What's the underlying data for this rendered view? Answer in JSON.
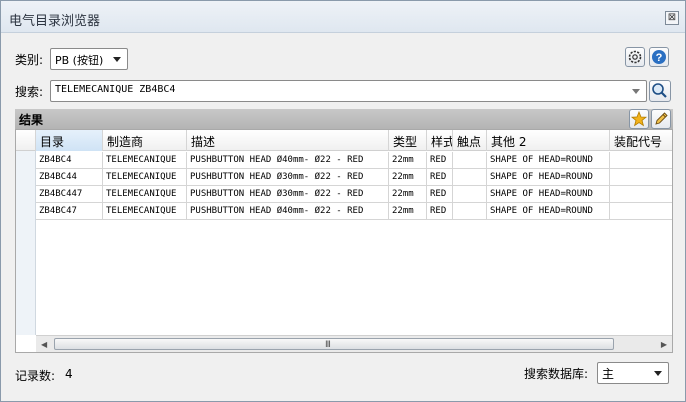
{
  "window": {
    "title": "电气目录浏览器",
    "close_label": "⊠"
  },
  "category": {
    "label": "类别:",
    "value": "PB (按钮)"
  },
  "search": {
    "label": "搜索:",
    "value": "TELEMECANIQUE ZB4BC4"
  },
  "results": {
    "label": "结果",
    "columns": [
      "目录",
      "制造商",
      "描述",
      "类型",
      "样式",
      "触点",
      "其他 2",
      "装配代号"
    ],
    "rows": [
      [
        "ZB4BC4",
        "TELEMECANIQUE",
        "PUSHBUTTON HEAD Ø40mm- Ø22 - RED",
        "22mm",
        "RED",
        "",
        "SHAPE OF HEAD=ROUND",
        ""
      ],
      [
        "ZB4BC44",
        "TELEMECANIQUE",
        "PUSHBUTTON HEAD Ø30mm- Ø22 - RED",
        "22mm",
        "RED",
        "",
        "SHAPE OF HEAD=ROUND",
        ""
      ],
      [
        "ZB4BC447",
        "TELEMECANIQUE",
        "PUSHBUTTON HEAD Ø30mm- Ø22 - RED",
        "22mm",
        "RED",
        "",
        "SHAPE OF HEAD=ROUND",
        ""
      ],
      [
        "ZB4BC47",
        "TELEMECANIQUE",
        "PUSHBUTTON HEAD Ø40mm- Ø22 - RED",
        "22mm",
        "RED",
        "",
        "SHAPE OF HEAD=ROUND",
        ""
      ]
    ],
    "scroll_grip": "III"
  },
  "footer": {
    "record_count_label": "记录数:",
    "record_count": "4",
    "db_label": "搜索数据库:",
    "db_value": "主"
  },
  "icons": {
    "settings": "gear-icon",
    "help": "help-icon",
    "search": "magnifier-icon",
    "favorite": "star-icon",
    "edit": "pencil-icon"
  },
  "colors": {
    "title_bg": "#dfe7f0",
    "section_bar": "#b4b4b4",
    "help_blue": "#2a6fc2",
    "star": "#f2b21b"
  }
}
